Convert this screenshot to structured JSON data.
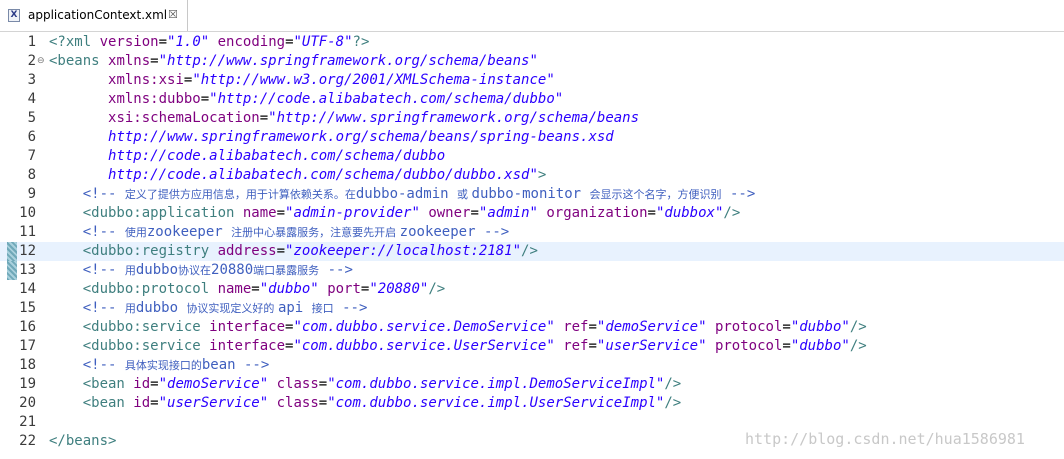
{
  "tab": {
    "icon": "xml-file-icon",
    "icon_glyph": "X",
    "title": "applicationContext.xml",
    "close_glyph": "☒"
  },
  "editor": {
    "current_line": 12,
    "lines": [
      {
        "n": "1",
        "tokens": [
          {
            "t": "<?xml ",
            "c": "tag"
          },
          {
            "t": "version",
            "c": "attr"
          },
          {
            "t": "=",
            "c": "text"
          },
          {
            "t": "\"1.0\"",
            "c": "val"
          },
          {
            "t": " ",
            "c": "text"
          },
          {
            "t": "encoding",
            "c": "attr"
          },
          {
            "t": "=",
            "c": "text"
          },
          {
            "t": "\"UTF-8\"",
            "c": "val"
          },
          {
            "t": "?>",
            "c": "tag"
          }
        ]
      },
      {
        "n": "2",
        "fold": true,
        "tokens": [
          {
            "t": "<beans ",
            "c": "tag"
          },
          {
            "t": "xmlns",
            "c": "attr"
          },
          {
            "t": "=",
            "c": "text"
          },
          {
            "t": "\"http://www.springframework.org/schema/beans\"",
            "c": "val"
          }
        ]
      },
      {
        "n": "3",
        "tokens": [
          {
            "t": "       ",
            "c": "text"
          },
          {
            "t": "xmlns:xsi",
            "c": "attr"
          },
          {
            "t": "=",
            "c": "text"
          },
          {
            "t": "\"http://www.w3.org/2001/XMLSchema-instance\"",
            "c": "val"
          }
        ]
      },
      {
        "n": "4",
        "tokens": [
          {
            "t": "       ",
            "c": "text"
          },
          {
            "t": "xmlns:dubbo",
            "c": "attr"
          },
          {
            "t": "=",
            "c": "text"
          },
          {
            "t": "\"http://code.alibabatech.com/schema/dubbo\"",
            "c": "val"
          }
        ]
      },
      {
        "n": "5",
        "tokens": [
          {
            "t": "       ",
            "c": "text"
          },
          {
            "t": "xsi:schemaLocation",
            "c": "attr"
          },
          {
            "t": "=",
            "c": "text"
          },
          {
            "t": "\"http://www.springframework.org/schema/beans",
            "c": "val"
          }
        ]
      },
      {
        "n": "6",
        "tokens": [
          {
            "t": "       ",
            "c": "text"
          },
          {
            "t": "http://www.springframework.org/schema/beans/spring-beans.xsd",
            "c": "val"
          }
        ]
      },
      {
        "n": "7",
        "tokens": [
          {
            "t": "       ",
            "c": "text"
          },
          {
            "t": "http://code.alibabatech.com/schema/dubbo",
            "c": "val"
          }
        ]
      },
      {
        "n": "8",
        "tokens": [
          {
            "t": "       ",
            "c": "text"
          },
          {
            "t": "http://code.alibabatech.com/schema/dubbo/dubbo.xsd\"",
            "c": "val"
          },
          {
            "t": ">",
            "c": "tag"
          }
        ]
      },
      {
        "n": "9",
        "tokens": [
          {
            "t": "    <!-- ",
            "c": "comment"
          },
          {
            "t": "定义了提供方应用信息，用于计算依赖关系。在",
            "c": "comment",
            "cjk": true
          },
          {
            "t": "dubbo-admin ",
            "c": "comment"
          },
          {
            "t": "或 ",
            "c": "comment",
            "cjk": true
          },
          {
            "t": "dubbo-monitor ",
            "c": "comment"
          },
          {
            "t": "会显示这个名字，方便识别",
            "c": "comment",
            "cjk": true
          },
          {
            "t": " -->",
            "c": "comment"
          }
        ]
      },
      {
        "n": "10",
        "tokens": [
          {
            "t": "    <dubbo:application ",
            "c": "tag"
          },
          {
            "t": "name",
            "c": "attr"
          },
          {
            "t": "=",
            "c": "text"
          },
          {
            "t": "\"admin-provider\"",
            "c": "val"
          },
          {
            "t": " ",
            "c": "text"
          },
          {
            "t": "owner",
            "c": "attr"
          },
          {
            "t": "=",
            "c": "text"
          },
          {
            "t": "\"admin\"",
            "c": "val"
          },
          {
            "t": " ",
            "c": "text"
          },
          {
            "t": "organization",
            "c": "attr"
          },
          {
            "t": "=",
            "c": "text"
          },
          {
            "t": "\"dubbox\"",
            "c": "val"
          },
          {
            "t": "/>",
            "c": "tag"
          }
        ]
      },
      {
        "n": "11",
        "tokens": [
          {
            "t": "    <!-- ",
            "c": "comment"
          },
          {
            "t": "使用",
            "c": "comment",
            "cjk": true
          },
          {
            "t": "zookeeper ",
            "c": "comment"
          },
          {
            "t": "注册中心暴露服务，注意要先开启 ",
            "c": "comment",
            "cjk": true
          },
          {
            "t": "zookeeper -->",
            "c": "comment"
          }
        ]
      },
      {
        "n": "12",
        "mark": true,
        "tokens": [
          {
            "t": "    <dubbo:registry ",
            "c": "tag"
          },
          {
            "t": "address",
            "c": "attr"
          },
          {
            "t": "=",
            "c": "text"
          },
          {
            "t": "\"zookeeper://localhost:2181\"",
            "c": "val"
          },
          {
            "t": "/>",
            "c": "tag"
          }
        ]
      },
      {
        "n": "13",
        "mark": true,
        "tokens": [
          {
            "t": "    <!-- ",
            "c": "comment"
          },
          {
            "t": "用",
            "c": "comment",
            "cjk": true
          },
          {
            "t": "dubbo",
            "c": "comment"
          },
          {
            "t": "协议在",
            "c": "comment",
            "cjk": true
          },
          {
            "t": "20880",
            "c": "comment"
          },
          {
            "t": "端口暴露服务",
            "c": "comment",
            "cjk": true
          },
          {
            "t": " -->",
            "c": "comment"
          }
        ]
      },
      {
        "n": "14",
        "tokens": [
          {
            "t": "    <dubbo:protocol ",
            "c": "tag"
          },
          {
            "t": "name",
            "c": "attr"
          },
          {
            "t": "=",
            "c": "text"
          },
          {
            "t": "\"dubbo\"",
            "c": "val"
          },
          {
            "t": " ",
            "c": "text"
          },
          {
            "t": "port",
            "c": "attr"
          },
          {
            "t": "=",
            "c": "text"
          },
          {
            "t": "\"20880\"",
            "c": "val"
          },
          {
            "t": "/>",
            "c": "tag"
          }
        ]
      },
      {
        "n": "15",
        "tokens": [
          {
            "t": "    <!-- ",
            "c": "comment"
          },
          {
            "t": "用",
            "c": "comment",
            "cjk": true
          },
          {
            "t": "dubbo ",
            "c": "comment"
          },
          {
            "t": "协议实现定义好的 ",
            "c": "comment",
            "cjk": true
          },
          {
            "t": "api ",
            "c": "comment"
          },
          {
            "t": "接口",
            "c": "comment",
            "cjk": true
          },
          {
            "t": " -->",
            "c": "comment"
          }
        ]
      },
      {
        "n": "16",
        "tokens": [
          {
            "t": "    <dubbo:service ",
            "c": "tag"
          },
          {
            "t": "interface",
            "c": "attr"
          },
          {
            "t": "=",
            "c": "text"
          },
          {
            "t": "\"com.dubbo.service.DemoService\"",
            "c": "val"
          },
          {
            "t": " ",
            "c": "text"
          },
          {
            "t": "ref",
            "c": "attr"
          },
          {
            "t": "=",
            "c": "text"
          },
          {
            "t": "\"demoService\"",
            "c": "val"
          },
          {
            "t": " ",
            "c": "text"
          },
          {
            "t": "protocol",
            "c": "attr"
          },
          {
            "t": "=",
            "c": "text"
          },
          {
            "t": "\"dubbo\"",
            "c": "val"
          },
          {
            "t": "/>",
            "c": "tag"
          }
        ]
      },
      {
        "n": "17",
        "tokens": [
          {
            "t": "    <dubbo:service ",
            "c": "tag"
          },
          {
            "t": "interface",
            "c": "attr"
          },
          {
            "t": "=",
            "c": "text"
          },
          {
            "t": "\"com.dubbo.service.UserService\"",
            "c": "val"
          },
          {
            "t": " ",
            "c": "text"
          },
          {
            "t": "ref",
            "c": "attr"
          },
          {
            "t": "=",
            "c": "text"
          },
          {
            "t": "\"userService\"",
            "c": "val"
          },
          {
            "t": " ",
            "c": "text"
          },
          {
            "t": "protocol",
            "c": "attr"
          },
          {
            "t": "=",
            "c": "text"
          },
          {
            "t": "\"dubbo\"",
            "c": "val"
          },
          {
            "t": "/>",
            "c": "tag"
          }
        ]
      },
      {
        "n": "18",
        "tokens": [
          {
            "t": "    <!-- ",
            "c": "comment"
          },
          {
            "t": "具体实现接口的",
            "c": "comment",
            "cjk": true
          },
          {
            "t": "bean -->",
            "c": "comment"
          }
        ]
      },
      {
        "n": "19",
        "tokens": [
          {
            "t": "    <bean ",
            "c": "tag"
          },
          {
            "t": "id",
            "c": "attr"
          },
          {
            "t": "=",
            "c": "text"
          },
          {
            "t": "\"demoService\"",
            "c": "val"
          },
          {
            "t": " ",
            "c": "text"
          },
          {
            "t": "class",
            "c": "attr"
          },
          {
            "t": "=",
            "c": "text"
          },
          {
            "t": "\"com.dubbo.service.impl.DemoServiceImpl\"",
            "c": "val"
          },
          {
            "t": "/>",
            "c": "tag"
          }
        ]
      },
      {
        "n": "20",
        "tokens": [
          {
            "t": "    <bean ",
            "c": "tag"
          },
          {
            "t": "id",
            "c": "attr"
          },
          {
            "t": "=",
            "c": "text"
          },
          {
            "t": "\"userService\"",
            "c": "val"
          },
          {
            "t": " ",
            "c": "text"
          },
          {
            "t": "class",
            "c": "attr"
          },
          {
            "t": "=",
            "c": "text"
          },
          {
            "t": "\"com.dubbo.service.impl.UserServiceImpl\"",
            "c": "val"
          },
          {
            "t": "/>",
            "c": "tag"
          }
        ]
      },
      {
        "n": "21",
        "tokens": []
      },
      {
        "n": "22",
        "tokens": [
          {
            "t": "</beans>",
            "c": "tag"
          }
        ]
      }
    ]
  },
  "watermark": "http://blog.csdn.net/hua1586981",
  "colors": {
    "tag": "#3f7f7f",
    "attr": "#7f007f",
    "value": "#2a00ff",
    "comment": "#3f5fbf",
    "current_line_bg": "#e8f2fe"
  }
}
